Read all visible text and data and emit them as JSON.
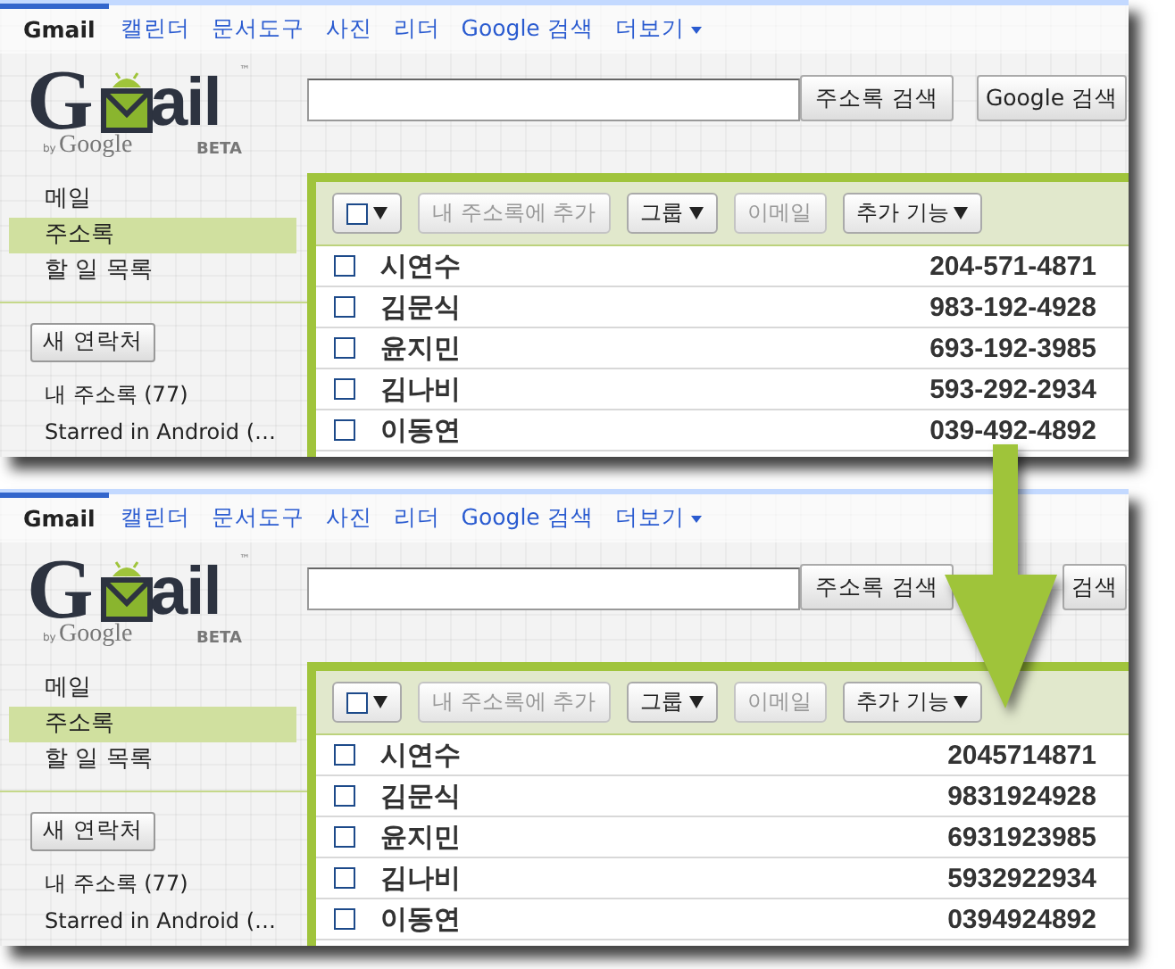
{
  "panels": [
    {
      "nav": [
        {
          "label": "Gmail",
          "selected": true,
          "menu": false
        },
        {
          "label": "캘린더",
          "selected": false,
          "menu": false
        },
        {
          "label": "문서도구",
          "selected": false,
          "menu": false
        },
        {
          "label": "사진",
          "selected": false,
          "menu": false
        },
        {
          "label": "리더",
          "selected": false,
          "menu": false
        },
        {
          "label": "Google 검색",
          "selected": false,
          "menu": false
        },
        {
          "label": "더보기",
          "selected": false,
          "menu": true
        }
      ],
      "logo": {
        "initial": "G",
        "rest": "ail",
        "trademark": "™",
        "by": "by",
        "company": "Google",
        "badge": "BETA"
      },
      "search": {
        "buttons": [
          "주소록 검색",
          "Google 검색"
        ]
      },
      "sidebar": {
        "items": [
          {
            "label": "메일",
            "selected": false
          },
          {
            "label": "주소록",
            "selected": true
          },
          {
            "label": "할 일 목록",
            "selected": false
          }
        ],
        "new_contact": "새 연락처",
        "groups": [
          "내 주소록 (77)",
          "Starred in Android (…"
        ]
      },
      "toolbar": [
        {
          "kind": "select",
          "checked": false,
          "disabled": false,
          "menu": true
        },
        {
          "kind": "button",
          "label": "내 주소록에 추가",
          "disabled": true,
          "menu": false
        },
        {
          "kind": "button",
          "label": "그룹",
          "disabled": false,
          "menu": true
        },
        {
          "kind": "button",
          "label": "이메일",
          "disabled": true,
          "menu": false
        },
        {
          "kind": "button",
          "label": "추가 기능",
          "disabled": false,
          "menu": true
        }
      ],
      "contacts": [
        {
          "name": "시연수",
          "phone": "204-571-4871",
          "checked": false
        },
        {
          "name": "김문식",
          "phone": "983-192-4928",
          "checked": false
        },
        {
          "name": "윤지민",
          "phone": "693-192-3985",
          "checked": false
        },
        {
          "name": "김나비",
          "phone": "593-292-2934",
          "checked": false
        },
        {
          "name": "이동연",
          "phone": "039-492-4892",
          "checked": false
        }
      ]
    },
    {
      "nav": [
        {
          "label": "Gmail",
          "selected": true,
          "menu": false
        },
        {
          "label": "캘린더",
          "selected": false,
          "menu": false
        },
        {
          "label": "문서도구",
          "selected": false,
          "menu": false
        },
        {
          "label": "사진",
          "selected": false,
          "menu": false
        },
        {
          "label": "리더",
          "selected": false,
          "menu": false
        },
        {
          "label": "Google 검색",
          "selected": false,
          "menu": false
        },
        {
          "label": "더보기",
          "selected": false,
          "menu": true
        }
      ],
      "logo": {
        "initial": "G",
        "rest": "ail",
        "trademark": "™",
        "by": "by",
        "company": "Google",
        "badge": "BETA"
      },
      "search": {
        "buttons": [
          "주소록 검색",
          "검색"
        ]
      },
      "sidebar": {
        "items": [
          {
            "label": "메일",
            "selected": false
          },
          {
            "label": "주소록",
            "selected": true
          },
          {
            "label": "할 일 목록",
            "selected": false
          }
        ],
        "new_contact": "새 연락처",
        "groups": [
          "내 주소록 (77)",
          "Starred in Android (…"
        ]
      },
      "toolbar": [
        {
          "kind": "select",
          "checked": false,
          "disabled": false,
          "menu": true
        },
        {
          "kind": "button",
          "label": "내 주소록에 추가",
          "disabled": true,
          "menu": false
        },
        {
          "kind": "button",
          "label": "그룹",
          "disabled": false,
          "menu": true
        },
        {
          "kind": "button",
          "label": "이메일",
          "disabled": true,
          "menu": false
        },
        {
          "kind": "button",
          "label": "추가 기능",
          "disabled": false,
          "menu": true
        }
      ],
      "contacts": [
        {
          "name": "시연수",
          "phone": "2045714871",
          "checked": false
        },
        {
          "name": "김문식",
          "phone": "9831924928",
          "checked": false
        },
        {
          "name": "윤지민",
          "phone": "6931923985",
          "checked": false
        },
        {
          "name": "김나비",
          "phone": "5932922934",
          "checked": false
        },
        {
          "name": "이동연",
          "phone": "0394924892",
          "checked": false
        }
      ]
    }
  ]
}
